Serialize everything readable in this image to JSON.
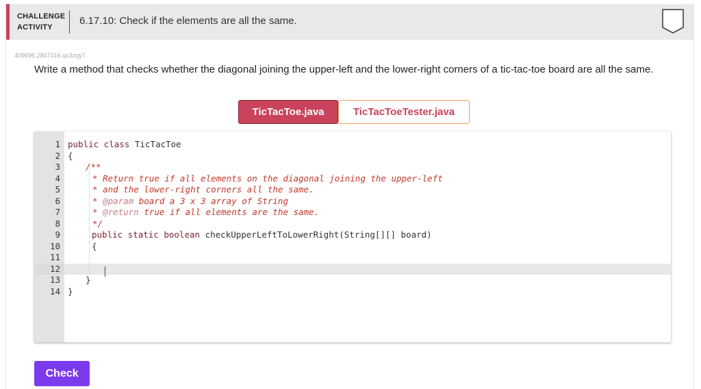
{
  "header": {
    "challenge_line1": "CHALLENGE",
    "challenge_line2": "ACTIVITY",
    "title": "6.17.10: Check if the elements are all the same."
  },
  "activity_id": "409696.2847416.qx3zqy7",
  "prompt": "Write a method that checks whether the diagonal joining the upper-left and the lower-right corners of a tic-tac-toe board are all the same.",
  "tabs": [
    {
      "label": "TicTacToe.java",
      "active": true
    },
    {
      "label": "TicTacToeTester.java",
      "active": false
    }
  ],
  "editor": {
    "line_numbers": [
      "1",
      "2",
      "3",
      "4",
      "5",
      "6",
      "7",
      "8",
      "9",
      "10",
      "11",
      "12",
      "13",
      "14"
    ],
    "lines": {
      "l1_kw": "public class ",
      "l1_plain": "TicTacToe",
      "l2": "{",
      "l3": "/**",
      "l4": "* Return true if all elements on the diagonal joining the upper-left",
      "l5": "* and the lower-right corners all the same.",
      "l6_star": "* ",
      "l6_tag": "@param",
      "l6_rest": " board a 3 x 3 array of String",
      "l7_star": "* ",
      "l7_tag": "@return",
      "l7_rest": " true if all elements are the same.",
      "l8": "*/",
      "l9_kw": "public static boolean ",
      "l9_plain": "checkUpperLeftToLowerRight(String[][] board)",
      "l10": "{",
      "l13": "}",
      "l14": "}"
    }
  },
  "check_button": "Check",
  "colors": {
    "accent": "#c8435b",
    "button": "#7c3aed"
  }
}
